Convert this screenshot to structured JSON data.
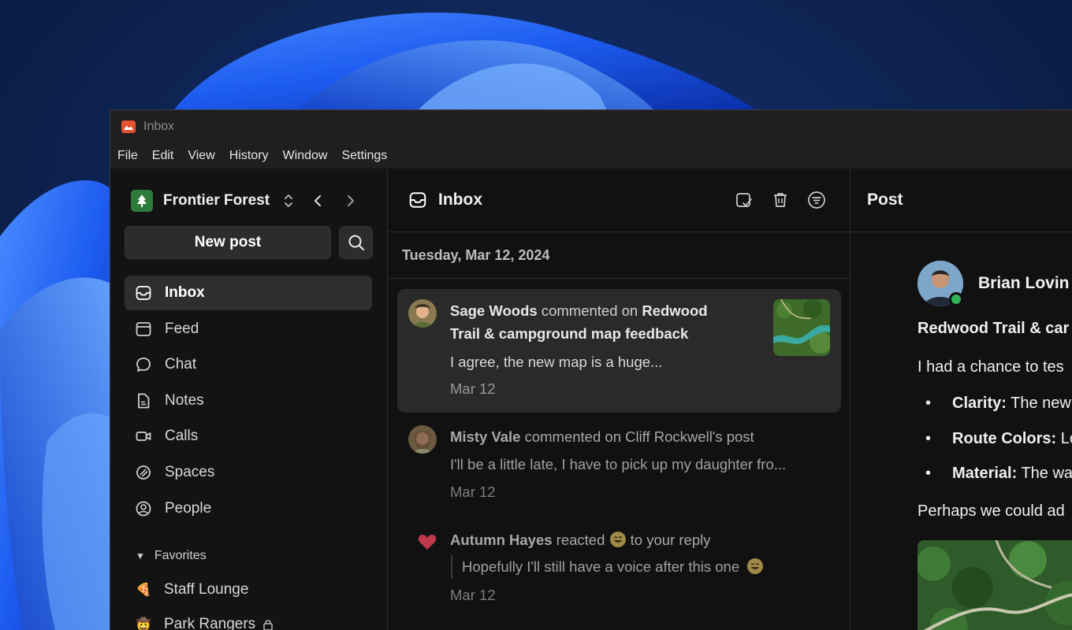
{
  "window": {
    "title": "Inbox"
  },
  "menu": [
    "File",
    "Edit",
    "View",
    "History",
    "Window",
    "Settings"
  ],
  "sidebar": {
    "workspace": "Frontier Forest",
    "new_post": "New post",
    "nav": [
      {
        "label": "Inbox",
        "icon": "inbox-icon",
        "active": true
      },
      {
        "label": "Feed",
        "icon": "feed-icon"
      },
      {
        "label": "Chat",
        "icon": "chat-icon"
      },
      {
        "label": "Notes",
        "icon": "notes-icon"
      },
      {
        "label": "Calls",
        "icon": "calls-icon"
      },
      {
        "label": "Spaces",
        "icon": "spaces-icon"
      },
      {
        "label": "People",
        "icon": "people-icon"
      }
    ],
    "favorites_label": "Favorites",
    "favorites": [
      {
        "label": "Staff Lounge",
        "emoji": "🍕"
      },
      {
        "label": "Park Rangers",
        "emoji": "🤠",
        "locked": true
      }
    ]
  },
  "inbox": {
    "title": "Inbox",
    "date": "Tuesday, Mar 12, 2024",
    "notifications": [
      {
        "actor": "Sage Woods",
        "action": " commented on ",
        "target": "Redwood Trail & campground map feedback",
        "target_line1": "Redwood",
        "target_line2": "Trail & campground map feedback",
        "preview": "I agree, the new map is a huge...",
        "time": "Mar 12",
        "selected": true
      },
      {
        "actor": "Misty Vale",
        "action": " commented on Cliff Rockwell's post",
        "preview": "I'll be a little late, I have to pick up my daughter fro...",
        "time": "Mar 12"
      },
      {
        "actor": "Autumn Hayes",
        "action": " reacted ",
        "action2": " to your reply",
        "preview": "Hopefully I'll still have a voice after this one",
        "time": "Mar 12"
      }
    ]
  },
  "post": {
    "header": "Post",
    "author": "Brian Lovin",
    "title": "Redwood Trail & car",
    "intro": "I had a chance to tes",
    "bullets": [
      {
        "label": "Clarity:",
        "text": " The new"
      },
      {
        "label": "Route Colors:",
        "text": " Lo"
      },
      {
        "label": "Material:",
        "text": " The wa"
      }
    ],
    "closing": "Perhaps we could ad"
  },
  "colors": {
    "accent": "#e4522f",
    "workspace": "#2d7a3a",
    "online": "#2fb25a",
    "heart": "#c0394b"
  }
}
